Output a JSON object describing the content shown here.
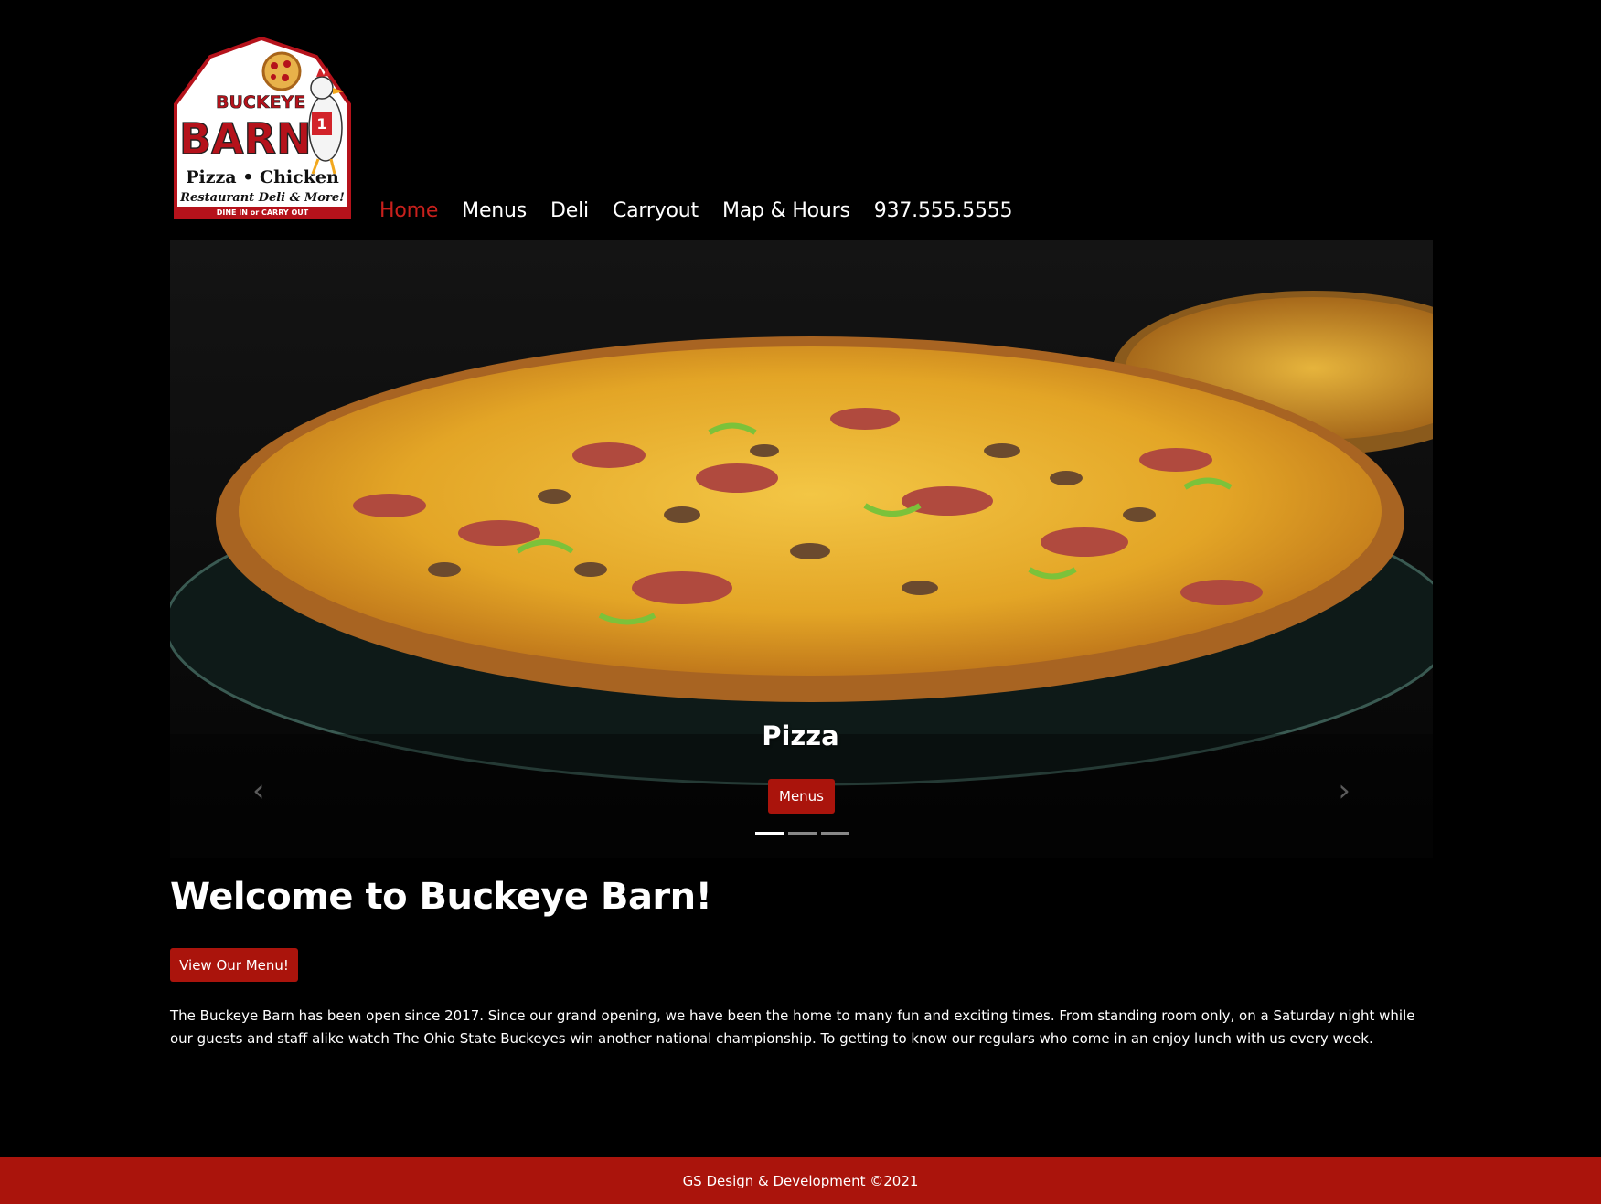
{
  "logo": {
    "line1": "BUCKEYE",
    "line2": "BARN",
    "line3": "Pizza • Chicken",
    "line4": "Restaurant Deli & More!",
    "line5": "DINE IN or CARRY OUT"
  },
  "nav": {
    "items": [
      {
        "label": "Home",
        "active": true
      },
      {
        "label": "Menus",
        "active": false
      },
      {
        "label": "Deli",
        "active": false
      },
      {
        "label": "Carryout",
        "active": false
      },
      {
        "label": "Map & Hours",
        "active": false
      },
      {
        "label": "937.555.5555",
        "active": false
      }
    ]
  },
  "carousel": {
    "caption_title": "Pizza",
    "caption_button": "Menus",
    "slide_count": 3,
    "active_slide": 1,
    "prev_icon": "chevron-left-icon",
    "next_icon": "chevron-right-icon"
  },
  "main": {
    "title": "Welcome to Buckeye Barn!",
    "cta_button": "View Our Menu!",
    "intro": "The Buckeye Barn has been open since 2017. Since our grand opening, we have been the home to many fun and exciting times. From standing room only, on a Saturday night while our guests and staff alike watch The Ohio State Buckeyes win another national championship. To getting to know our regulars who come in an enjoy lunch with us every week."
  },
  "footer": {
    "text": "GS Design & Development ©2021"
  },
  "colors": {
    "accent": "#aa140c",
    "nav_active": "#c8201c",
    "background": "#000000"
  }
}
